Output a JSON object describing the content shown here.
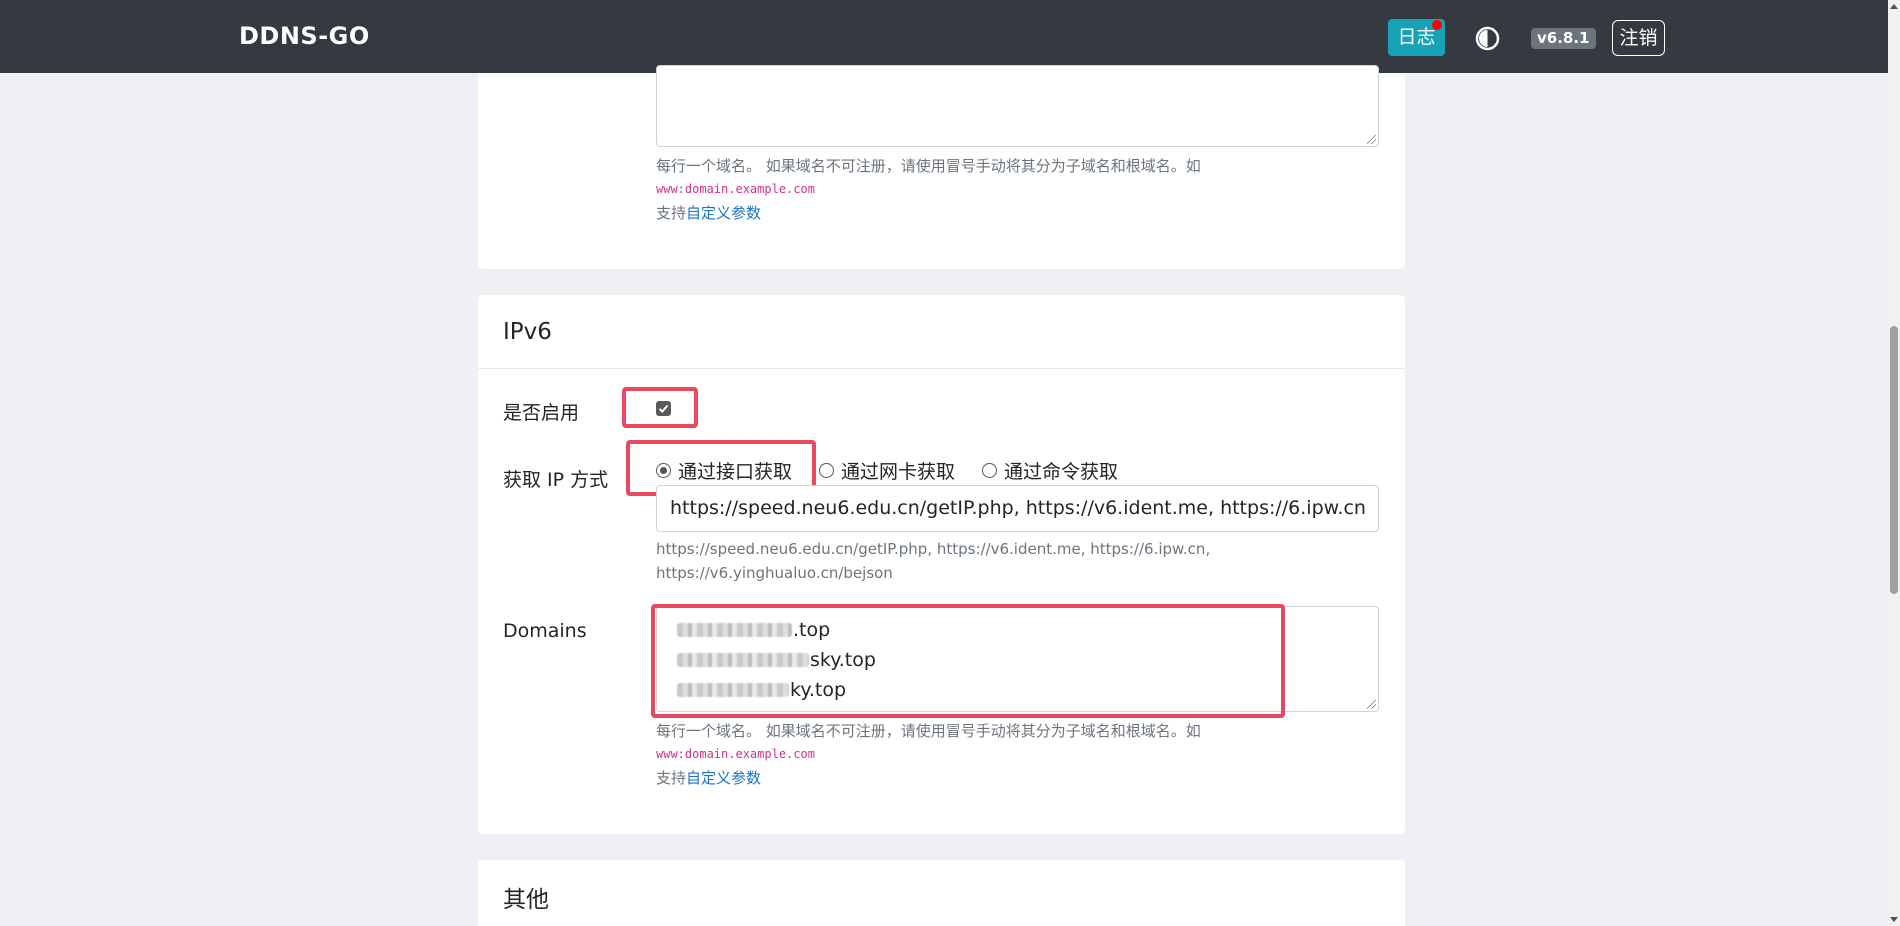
{
  "navbar": {
    "brand": "DDNS-GO",
    "log_button": "日志",
    "theme_icon": "half-circle-theme-icon",
    "version": "v6.8.1",
    "logout_button": "注销"
  },
  "ipv4_tail": {
    "domain_help": "每行一个域名。 如果域名不可注册，请使用冒号手动将其分为子域名和根域名。如",
    "domain_example": "www:domain.example.com",
    "support_prefix": "支持",
    "support_link": "自定义参数"
  },
  "ipv6": {
    "title": "IPv6",
    "enable_label": "是否启用",
    "enabled": true,
    "method_label": "获取 IP 方式",
    "methods": [
      {
        "label": "通过接口获取",
        "selected": true
      },
      {
        "label": "通过网卡获取",
        "selected": false
      },
      {
        "label": "通过命令获取",
        "selected": false
      }
    ],
    "url_value": "https://speed.neu6.edu.cn/getIP.php, https://v6.ident.me, https://6.ipw.cn",
    "url_help_1": "https://speed.neu6.edu.cn/getIP.php, https://v6.ident.me, https://6.ipw.cn,",
    "url_help_2": "https://v6.yinghualuo.cn/bejson",
    "domains_label": "Domains",
    "domains": [
      ".top",
      "sky.top",
      "ky.top"
    ],
    "domain_help": "每行一个域名。 如果域名不可注册，请使用冒号手动将其分为子域名和根域名。如",
    "domain_example": "www:domain.example.com",
    "support_prefix": "支持",
    "support_link": "自定义参数"
  },
  "other": {
    "title": "其他"
  },
  "colors": {
    "navbar": "#343a40",
    "log_button": "#17a2b8",
    "highlight": "#e8485f",
    "link": "#1a73c8",
    "code": "#d63384"
  }
}
